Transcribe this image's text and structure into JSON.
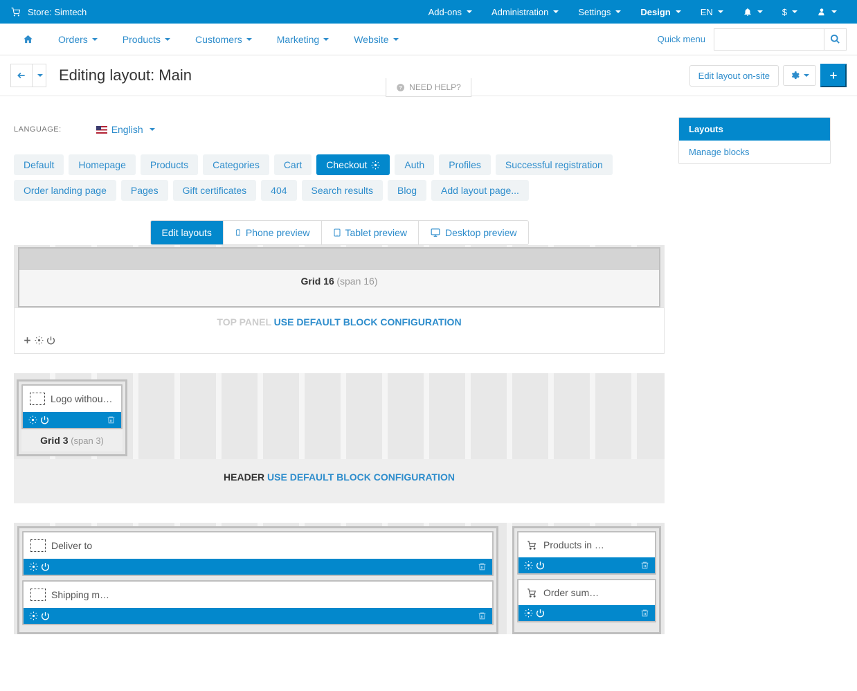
{
  "topbar": {
    "store_prefix": "Store:",
    "store_name": "Simtech",
    "menus": {
      "addons": "Add-ons",
      "administration": "Administration",
      "settings": "Settings",
      "design": "Design",
      "lang": "EN",
      "currency": "$"
    }
  },
  "mainnav": {
    "orders": "Orders",
    "products": "Products",
    "customers": "Customers",
    "marketing": "Marketing",
    "website": "Website",
    "quickmenu": "Quick menu"
  },
  "page": {
    "title": "Editing layout: Main",
    "edit_onsite": "Edit layout on-site",
    "need_help": "NEED HELP?"
  },
  "sidebar": {
    "layouts": "Layouts",
    "manage_blocks": "Manage blocks"
  },
  "lang": {
    "label": "LANGUAGE:",
    "value": "English"
  },
  "pills": [
    "Default",
    "Homepage",
    "Products",
    "Categories",
    "Cart",
    "Checkout",
    "Auth",
    "Profiles",
    "Successful registration",
    "Order landing page",
    "Pages",
    "Gift certificates",
    "404",
    "Search results",
    "Blog",
    "Add layout page..."
  ],
  "pill_active_index": 5,
  "view_tabs": {
    "edit": "Edit layouts",
    "phone": "Phone preview",
    "tablet": "Tablet preview",
    "desktop": "Desktop preview"
  },
  "top_panel": {
    "grid_label": "Grid 16",
    "grid_span": "(span 16)",
    "title_muted": "TOP PANEL",
    "title_link": "USE DEFAULT BLOCK CONFIGURATION"
  },
  "header_section": {
    "block_label": "Logo withou…",
    "grid_label": "Grid 3",
    "grid_span": "(span 3)",
    "title": "HEADER",
    "title_link": "USE DEFAULT BLOCK CONFIGURATION"
  },
  "content_section": {
    "left_blocks": [
      "Deliver to",
      "Shipping m…"
    ],
    "right_blocks": [
      "Products in …",
      "Order sum…"
    ]
  }
}
